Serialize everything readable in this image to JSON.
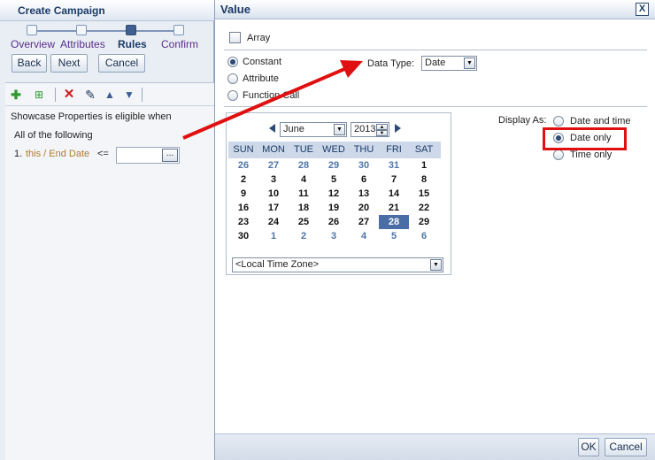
{
  "wizard": {
    "title": "Create Campaign",
    "steps": [
      {
        "label": "Overview"
      },
      {
        "label": "Attributes"
      },
      {
        "label": "Rules"
      },
      {
        "label": "Confirm"
      }
    ],
    "current_step": "Rules",
    "buttons": {
      "back": "Back",
      "next": "Next",
      "cancel": "Cancel"
    }
  },
  "rules": {
    "toolbar": [
      "add-icon",
      "add-child-icon",
      "delete-icon",
      "edit-icon",
      "move-up-icon",
      "move-down-icon"
    ],
    "header": "Showcase Properties is eligible when",
    "group": "All of the following",
    "row": {
      "number": "1.",
      "attribute": "this / End Date",
      "operator": "<=",
      "value": "",
      "picker_label": "..."
    }
  },
  "dialog": {
    "title": "Value",
    "close_label": "X",
    "array_label": "Array",
    "value_types": [
      {
        "label": "Constant",
        "selected": true
      },
      {
        "label": "Attribute",
        "selected": false
      },
      {
        "label": "Function Call",
        "selected": false
      }
    ],
    "data_type_label": "Data Type:",
    "data_type_value": "Date",
    "display_as_label": "Display As:",
    "display_options": [
      {
        "label": "Date and time",
        "selected": false
      },
      {
        "label": "Date only",
        "selected": true
      },
      {
        "label": "Time only",
        "selected": false
      }
    ],
    "ok_label": "OK",
    "cancel_label": "Cancel"
  },
  "calendar": {
    "month": "June",
    "year": "2013",
    "days_of_week": [
      "SUN",
      "MON",
      "TUE",
      "WED",
      "THU",
      "FRI",
      "SAT"
    ],
    "weeks": [
      [
        "26",
        "27",
        "28",
        "29",
        "30",
        "31",
        "1"
      ],
      [
        "2",
        "3",
        "4",
        "5",
        "6",
        "7",
        "8"
      ],
      [
        "9",
        "10",
        "11",
        "12",
        "13",
        "14",
        "15"
      ],
      [
        "16",
        "17",
        "18",
        "19",
        "20",
        "21",
        "22"
      ],
      [
        "23",
        "24",
        "25",
        "26",
        "27",
        "28",
        "29"
      ],
      [
        "30",
        "1",
        "2",
        "3",
        "4",
        "5",
        "6"
      ]
    ],
    "other_month": [
      [
        true,
        true,
        true,
        true,
        true,
        true,
        false
      ],
      [
        false,
        false,
        false,
        false,
        false,
        false,
        false
      ],
      [
        false,
        false,
        false,
        false,
        false,
        false,
        false
      ],
      [
        false,
        false,
        false,
        false,
        false,
        false,
        false
      ],
      [
        false,
        false,
        false,
        false,
        false,
        false,
        false
      ],
      [
        false,
        true,
        true,
        true,
        true,
        true,
        true
      ]
    ],
    "selected_day": "28",
    "timezone": "<Local Time Zone>"
  },
  "colors": {
    "annotation": "#e01010",
    "selected_day": "#4a6da6",
    "header_text": "#1b3a66"
  }
}
